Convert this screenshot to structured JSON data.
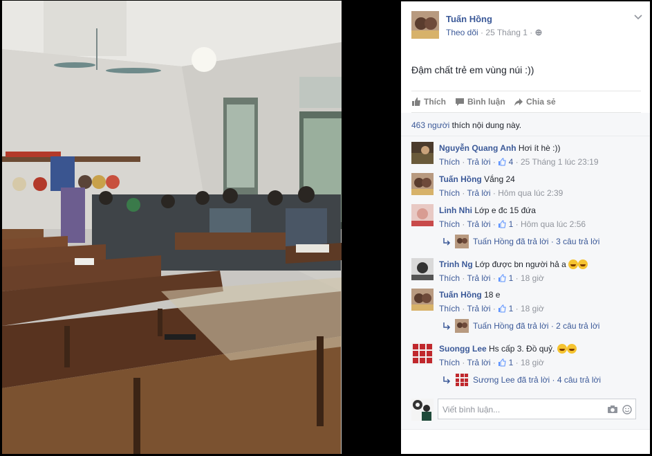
{
  "post": {
    "author": "Tuấn Hồng",
    "follow_label": "Theo dõi",
    "date": "25 Tháng 1",
    "text": "Đậm chất trẻ em vùng núi :))"
  },
  "actions": {
    "like": "Thích",
    "comment": "Bình luận",
    "share": "Chia sẻ"
  },
  "likes": {
    "count": "463 người",
    "suffix": "thích nội dung này."
  },
  "labels": {
    "like": "Thích",
    "reply": "Trả lời",
    "sep": "·"
  },
  "comments": [
    {
      "name": "Nguyễn Quang Anh",
      "text": "Hơi ít hè :))",
      "likes": "4",
      "time": "25 Tháng 1 lúc 23:19"
    },
    {
      "name": "Tuấn Hồng",
      "text": "Vắng 24",
      "likes": "",
      "time": "Hôm qua lúc 2:39"
    },
    {
      "name": "Linh Nhi",
      "text": "Lớp e đc 15 đứa",
      "likes": "1",
      "time": "Hôm qua lúc 2:56",
      "reply": "Tuấn Hồng đã trả lời · 3 câu trả lời"
    },
    {
      "name": "Trinh Ng",
      "text": "Lớp được bn người hả a",
      "likes": "1",
      "time": "18 giờ"
    },
    {
      "name": "Tuấn Hồng",
      "text": "18 e",
      "likes": "1",
      "time": "18 giờ",
      "reply": "Tuấn Hồng đã trả lời · 2 câu trả lời"
    },
    {
      "name": "Suongg Lee",
      "text": "Hs cấp 3. Đồ quỷ.",
      "likes": "1",
      "time": "18 giờ",
      "reply": "Sương Lee đã trả lời · 4 câu trả lời"
    }
  ],
  "write": {
    "placeholder": "Viết bình luận..."
  },
  "icons": [
    "chevron-down-icon",
    "globe-icon",
    "thumbs-up-icon",
    "comment-icon",
    "share-icon",
    "reply-arrow-icon",
    "camera-icon",
    "smiley-icon"
  ]
}
